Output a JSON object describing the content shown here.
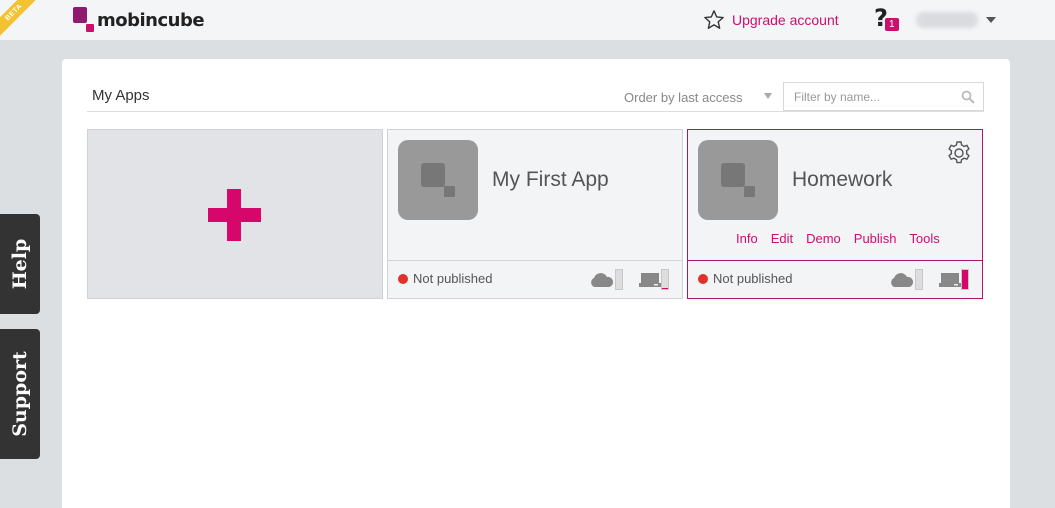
{
  "beta_label": "BETA",
  "brand": {
    "name": "mobincube"
  },
  "header": {
    "upgrade_label": "Upgrade account",
    "help_badge": "1",
    "help_glyph": "?"
  },
  "side_tabs": {
    "help": "Help",
    "support": "Support"
  },
  "main": {
    "title": "My Apps",
    "order_label": "Order by last access",
    "filter_placeholder": "Filter by name...",
    "new_app_glyph": "+"
  },
  "apps": [
    {
      "name": "My First App",
      "status": "Not published",
      "links": [],
      "device_fill": 0.05
    },
    {
      "name": "Homework",
      "status": "Not published",
      "links": [
        "Info",
        "Edit",
        "Demo",
        "Publish",
        "Tools"
      ],
      "device_fill": 1.0
    }
  ],
  "colors": {
    "accent": "#cc0f6d",
    "status_unpublished": "#e0312b",
    "selected_border": "#a3196e"
  }
}
